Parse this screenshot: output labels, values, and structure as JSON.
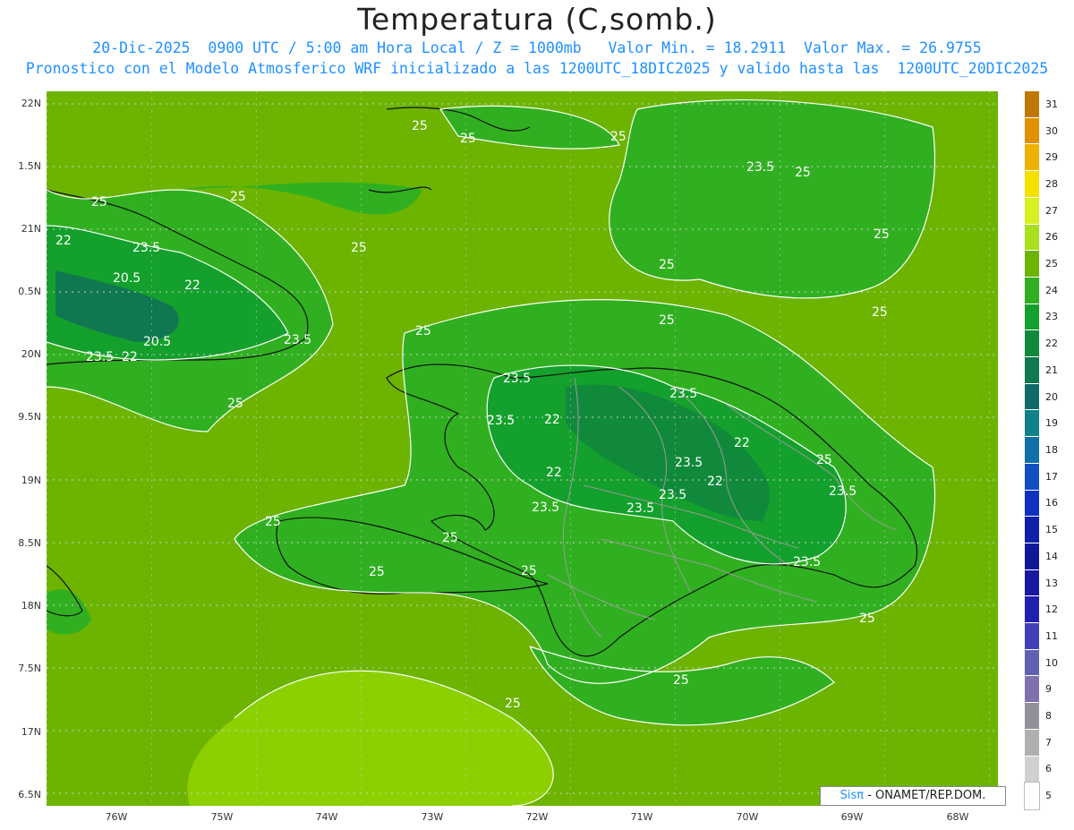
{
  "title": "Temperatura (C,somb.)",
  "subtitle_line1": "20-Dic-2025  0900 UTC / 5:00 am Hora Local / Z = 1000mb   Valor Min. = 18.2911  Valor Max. = 26.9755",
  "subtitle_line2": "Pronostico con el Modelo Atmosferico WRF inicializado a las 1200UTC_18DIC2025 y valido hasta las  1200UTC_20DIC2025",
  "lat_labels": [
    "22N",
    "1.5N",
    "21N",
    "0.5N",
    "20N",
    "9.5N",
    "19N",
    "8.5N",
    "18N",
    "7.5N",
    "17N",
    "6.5N"
  ],
  "lon_labels": [
    "76W",
    "75W",
    "74W",
    "73W",
    "72W",
    "71W",
    "70W",
    "69W",
    "68W"
  ],
  "colorbar": {
    "labels": [
      "31",
      "30",
      "29",
      "28",
      "27",
      "26",
      "25",
      "24",
      "23",
      "22",
      "21",
      "20",
      "19",
      "18",
      "17",
      "16",
      "15",
      "14",
      "13",
      "12",
      "11",
      "10",
      "9",
      "8",
      "7",
      "6",
      "5"
    ],
    "colors": [
      "#c07800",
      "#e09000",
      "#f0b000",
      "#f5e000",
      "#d8f020",
      "#a8e020",
      "#6cb400",
      "#30b020",
      "#14a02c",
      "#108a3a",
      "#107850",
      "#0f6a6a",
      "#10808a",
      "#1070a8",
      "#1050c0",
      "#1030c0",
      "#1020a8",
      "#101898",
      "#1818a0",
      "#2020b0",
      "#4040b8",
      "#6060b0",
      "#8070b0",
      "#909098",
      "#b0b0b0",
      "#d0d0d0",
      "#ffffff"
    ]
  },
  "contour_labels": [
    "25",
    "23.5",
    "22",
    "20.5"
  ],
  "credit": {
    "brand": "Sisπ",
    "text": " - ONAMET/REP.DOM."
  }
}
